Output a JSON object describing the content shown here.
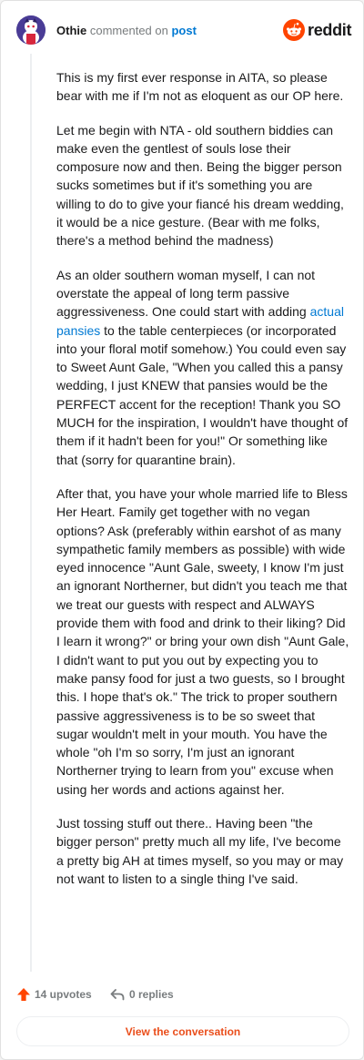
{
  "colors": {
    "brand": "#ff4500",
    "link": "#0079d3",
    "muted": "#787c7e",
    "cta": "#ea4e1b"
  },
  "header": {
    "author": "Othie",
    "action": "commented on",
    "post_link": "post",
    "logo_text": "reddit",
    "avatar_icon": "snoo-avatar-icon",
    "logo_icon": "reddit-snoo-icon"
  },
  "comment": {
    "p1": "This is my first ever response in AITA, so please bear with me if I'm not as eloquent as our OP here.",
    "p2": "Let me begin with NTA - old southern biddies can make even the gentlest of souls lose their composure now and then. Being the bigger person sucks sometimes but if it's something you are willing to do to give your fiancé his dream wedding, it would be a nice gesture. (Bear with me folks, there's a method behind the madness)",
    "p3_before": "As an older southern woman myself, I can not overstate the appeal of long term passive aggressiveness. One could start with adding ",
    "p3_link": "actual pansies",
    "p3_after": " to the table centerpieces (or incorporated into your floral motif somehow.) You could even say to Sweet Aunt Gale, \"When you called this a pansy wedding, I just KNEW that pansies would be the PERFECT accent for the reception! Thank you SO MUCH for the inspiration, I wouldn't have thought of them if it hadn't been for you!\" Or something like that (sorry for quarantine brain).",
    "p4": "After that, you have your whole married life to Bless Her Heart. Family get together with no vegan options? Ask (preferably within earshot of as many sympathetic family members as possible) with wide eyed innocence \"Aunt Gale, sweety, I know I'm just an ignorant Northerner, but didn't you teach me that we treat our guests with respect and ALWAYS provide them with food and drink to their liking? Did I learn it wrong?\" or bring your own dish \"Aunt Gale, I didn't want to put you out by expecting you to make pansy food for just a two guests, so I brought this. I hope that's ok.\" The trick to proper southern passive aggressiveness is to be so sweet that sugar wouldn't melt in your mouth. You have the whole \"oh I'm so sorry, I'm just an ignorant Northerner trying to learn from you\" excuse when using her words and actions against her.",
    "p5": "Just tossing stuff out there.. Having been \"the bigger person\" pretty much all my life, I've become a pretty big AH at times myself, so you may or may not want to listen to a single thing I've said."
  },
  "footer": {
    "upvotes": "14 upvotes",
    "replies": "0 replies",
    "upvote_icon": "upvote-arrow-icon",
    "reply_icon": "reply-arrow-icon"
  },
  "cta": {
    "label": "View the conversation"
  }
}
